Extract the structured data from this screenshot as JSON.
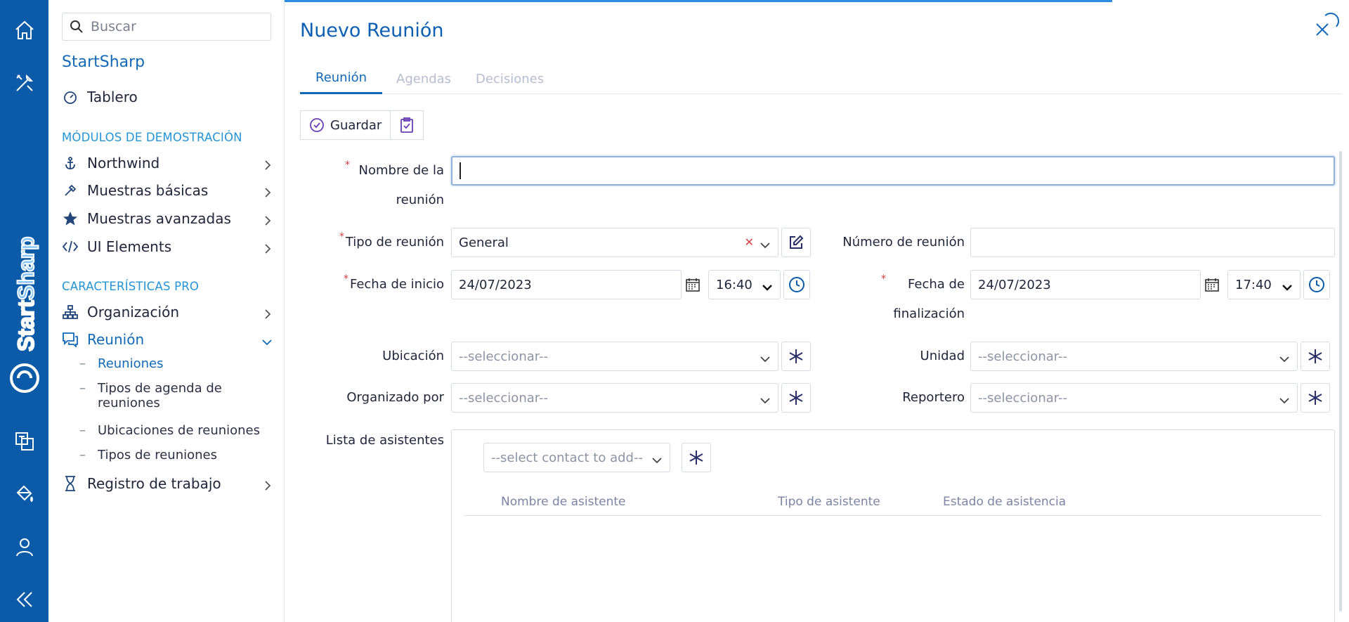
{
  "sidebar": {
    "search_placeholder": "Buscar",
    "app_title": "StartSharp",
    "dashboard": "Tablero",
    "section_demo": "MÓDULOS DE DEMOSTRACIÓN",
    "demo_items": [
      "Northwind",
      "Muestras básicas",
      "Muestras avanzadas",
      "UI Elements"
    ],
    "section_pro": "CARACTERÍSTICAS PRO",
    "organization": "Organización",
    "meeting": "Reunión",
    "meeting_sub": [
      "Reuniones",
      "Tipos de agenda de reuniones",
      "Ubicaciones de reuniones",
      "Tipos de reuniones"
    ],
    "worklog": "Registro de trabajo",
    "brand_text": "StartSharp"
  },
  "dialog": {
    "title": "Nuevo Reunión",
    "tabs": [
      "Reunión",
      "Agendas",
      "Decisiones"
    ],
    "save_label": "Guardar"
  },
  "form": {
    "name_label": "Nombre de la reunión",
    "name_value": "",
    "type_label": "Tipo de reunión",
    "type_value": "General",
    "number_label": "Número de reunión",
    "number_value": "",
    "start_label": "Fecha de inicio",
    "start_date": "24/07/2023",
    "start_time": "16:40",
    "end_label": "Fecha de finalización",
    "end_date": "24/07/2023",
    "end_time": "17:40",
    "location_label": "Ubicación",
    "unit_label": "Unidad",
    "organizer_label": "Organizado por",
    "reporter_label": "Reportero",
    "select_placeholder": "--seleccionar--",
    "attendees_label": "Lista de asistentes",
    "attendee_placeholder": "--select contact to add--",
    "attendee_columns": [
      "Nombre de asistente",
      "Tipo de asistente",
      "Estado de asistencia"
    ]
  },
  "colors": {
    "rail": "#0b5ba8",
    "accent": "#1269b8",
    "section": "#2394d6",
    "required": "#d83a3a"
  }
}
